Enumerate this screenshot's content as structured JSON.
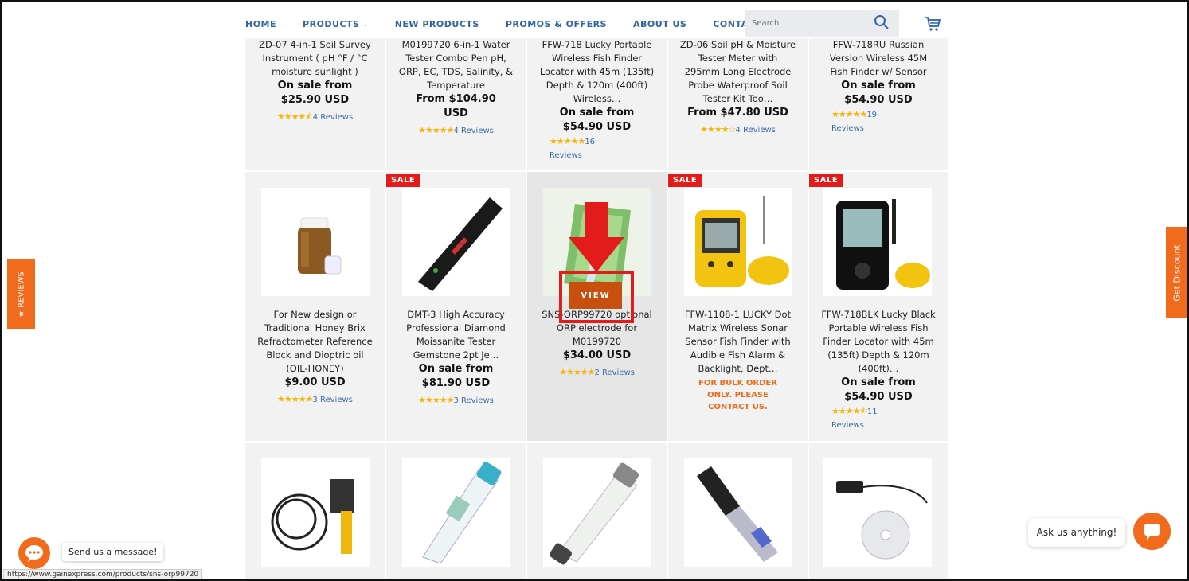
{
  "nav": {
    "items": [
      "HOME",
      "PRODUCTS",
      "NEW PRODUCTS",
      "PROMOS & OFFERS",
      "ABOUT US",
      "CONTACT US"
    ],
    "search_placeholder": "Search"
  },
  "row1": [
    {
      "title": "ZD-07 4-in-1 Soil Survey Instrument ( pH °F / °C moisture sunlight )",
      "price_label": "On sale from",
      "price": "$25.90 USD",
      "stars": "★★★★⯪",
      "reviews": "4 Reviews"
    },
    {
      "title": "M0199720 6-in-1 Water Tester Combo Pen pH, ORP, EC, TDS, Salinity, & Temperature",
      "price_label": "From $104.90",
      "price": "USD",
      "stars": "★★★★★",
      "reviews": "4 Reviews"
    },
    {
      "title": "FFW-718 Lucky Portable Wireless Fish Finder Locator with 45m (135ft) Depth & 120m (400ft) Wireless…",
      "price_label": "On sale from",
      "price": "$54.90 USD",
      "stars": "★★★★★",
      "reviews_count": "16",
      "reviews": "Reviews"
    },
    {
      "title": "ZD-06 Soil pH & Moisture Tester Meter with 295mm Long Electrode Probe Waterproof Soil Tester Kit Too…",
      "price_label": "From $47.80 USD",
      "price": "",
      "stars": "★★★★☆",
      "reviews": "4 Reviews"
    },
    {
      "title": "FFW-718RU Russian Version Wireless 45M Fish Finder w/ Sensor",
      "price_label": "On sale from",
      "price": "$54.90 USD",
      "stars": "★★★★★",
      "reviews_count": "19",
      "reviews": "Reviews"
    }
  ],
  "row2": [
    {
      "sale": "",
      "title": "For New design or Traditional Honey Brix Refractometer Reference Block and Dioptric oil (OIL-HONEY)",
      "price_label": "$9.00 USD",
      "stars": "★★★★★",
      "reviews": "3 Reviews"
    },
    {
      "sale": "SALE",
      "title": "DMT-3 High Accuracy Professional Diamond Moissanite Tester Gemstone 2pt Je…",
      "price_label": "On sale from",
      "price": "$81.90 USD",
      "stars": "★★★★★",
      "reviews": "3 Reviews"
    },
    {
      "sale": "",
      "title": "SNS-ORP99720 optional ORP electrode for M0199720",
      "price_label": "$34.00 USD",
      "stars": "★★★★★",
      "reviews": "2 Reviews",
      "view": "VIEW"
    },
    {
      "sale": "SALE",
      "title": "FFW-1108-1 LUCKY Dot Matrix Wireless Sonar Sensor Fish Finder with Audible Fish Alarm & Backlight, Dept…",
      "bulk": "FOR BULK ORDER ONLY. PLEASE CONTACT US."
    },
    {
      "sale": "SALE",
      "title": "FFW-718BLK Lucky Black Portable Wireless Fish Finder Locator with 45m (135ft) Depth & 120m (400ft)…",
      "price_label": "On sale from",
      "price": "$54.90 USD",
      "stars": "★★★★⯪",
      "reviews_count": "11",
      "reviews": "Reviews"
    }
  ],
  "side": {
    "reviews_tab": "★ REVIEWS",
    "discount_tab": "Get Discount"
  },
  "chat": {
    "left_label": "Send us a message!",
    "right_label": "Ask us anything!"
  },
  "status_url": "https://www.gainexpress.com/products/sns-orp99720"
}
